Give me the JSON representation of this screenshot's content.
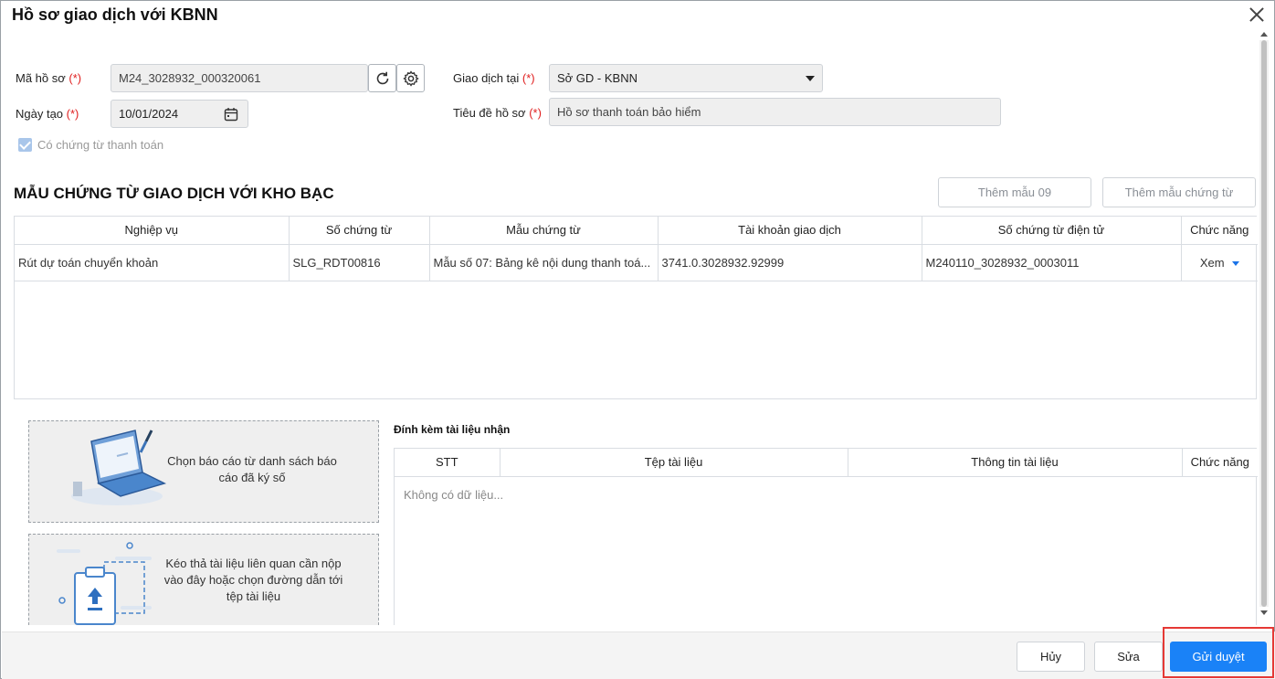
{
  "dialog": {
    "title": "Hồ sơ giao dịch với KBNN"
  },
  "form": {
    "ma_ho_so": {
      "label": "Mã hồ sơ",
      "required": "(*)",
      "value": "M24_3028932_000320061"
    },
    "ngay_tao": {
      "label": "Ngày tạo",
      "required": "(*)",
      "value": "10/01/2024"
    },
    "giao_dich_tai": {
      "label": "Giao dịch tại",
      "required": "(*)",
      "value": "Sở GD - KBNN"
    },
    "tieu_de": {
      "label": "Tiêu đề hồ sơ",
      "required": "(*)",
      "value": "Hồ sơ thanh toán bảo hiểm"
    },
    "co_chung_tu": {
      "label": "Có chứng từ thanh toán",
      "checked": true
    }
  },
  "section": {
    "title": "MẪU CHỨNG TỪ GIAO DỊCH VỚI KHO BẠC",
    "add_09": "Thêm mẫu 09",
    "add_template": "Thêm mẫu chứng từ"
  },
  "doc_table": {
    "headers": [
      "Nghiệp vụ",
      "Số chứng từ",
      "Mẫu chứng từ",
      "Tài khoản giao dịch",
      "Số chứng từ điện tử",
      "Chức năng"
    ],
    "rows": [
      {
        "nghiep_vu": "Rút dự toán chuyển khoản",
        "so_chung_tu": "SLG_RDT00816",
        "mau_chung_tu": "Mẫu số 07: Bảng kê nội dung thanh toá...",
        "tai_khoan": "3741.0.3028932.92999",
        "so_dien_tu": "M240110_3028932_0003011",
        "action": "Xem"
      }
    ]
  },
  "upload": {
    "choose_report": "Chọn báo cáo từ danh sách báo cáo đã ký số",
    "drag_drop": "Kéo thả tài liệu liên quan cần nộp vào đây hoặc chọn đường dẫn tới tệp tài liệu"
  },
  "attach": {
    "title": "Đính kèm tài liệu nhận",
    "headers": [
      "STT",
      "Tệp tài liệu",
      "Thông tin tài liệu",
      "Chức năng"
    ],
    "empty": "Không có dữ liệu..."
  },
  "footer": {
    "cancel": "Hủy",
    "edit": "Sửa",
    "submit": "Gửi duyệt"
  },
  "colors": {
    "primary": "#1a82f7",
    "link": "#1a73e8",
    "required": "#e02020",
    "highlight": "#e53935"
  }
}
